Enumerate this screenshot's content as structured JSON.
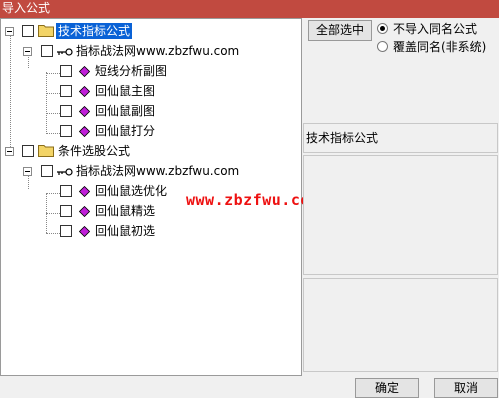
{
  "window": {
    "title": "导入公式"
  },
  "tree": {
    "groups": [
      {
        "label": "技术指标公式",
        "selected": true,
        "author": "指标战法网www.zbzfwu.com",
        "items": [
          "短线分析副图",
          "回仙鼠主图",
          "回仙鼠副图",
          "回仙鼠打分"
        ]
      },
      {
        "label": "条件选股公式",
        "selected": false,
        "author": "指标战法网www.zbzfwu.com",
        "items": [
          "回仙鼠选优化",
          "回仙鼠精选",
          "回仙鼠初选"
        ]
      }
    ]
  },
  "watermark": "www.zbzfwu.com",
  "options": {
    "select_all_label": "全部选中",
    "radios": [
      {
        "label": "不导入同名公式",
        "checked": true
      },
      {
        "label": "覆盖同名(非系统)",
        "checked": false
      }
    ]
  },
  "info": {
    "selected_group": "技术指标公式"
  },
  "footer": {
    "ok_label": "确定",
    "cancel_label": "取消"
  },
  "colors": {
    "titlebar": "#c14a40",
    "selection": "#0a62d6",
    "watermark": "#ee1111",
    "folder": "#f3d466",
    "diamond": "#c01ed8"
  }
}
